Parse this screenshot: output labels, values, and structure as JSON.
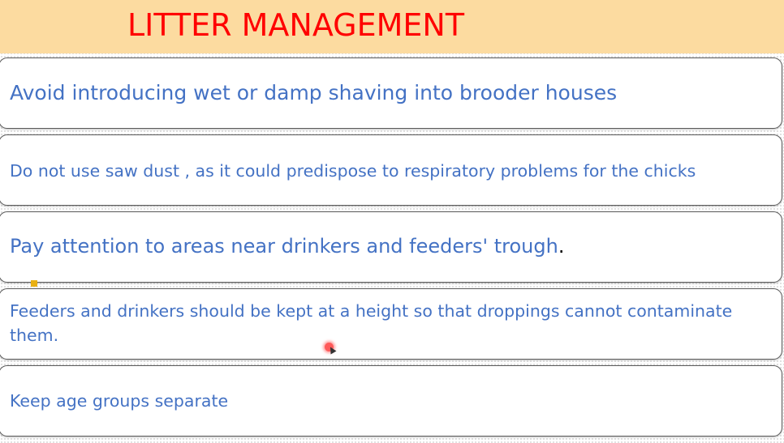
{
  "colors": {
    "title": "#ff0000",
    "body_text": "#4472c4",
    "header_bg": "#fcdba0"
  },
  "slide": {
    "title": "LITTER MANAGEMENT",
    "items": [
      {
        "text": "Avoid introducing wet or damp shaving into brooder houses"
      },
      {
        "text": "Do not use saw dust , as it could predispose to respiratory problems for the chicks"
      },
      {
        "text": "Pay attention to areas near drinkers and feeders' trough",
        "trailing": "."
      },
      {
        "text": "Feeders and drinkers should be kept at a height so that droppings cannot contaminate them."
      },
      {
        "text": "Keep age groups separate"
      }
    ]
  }
}
